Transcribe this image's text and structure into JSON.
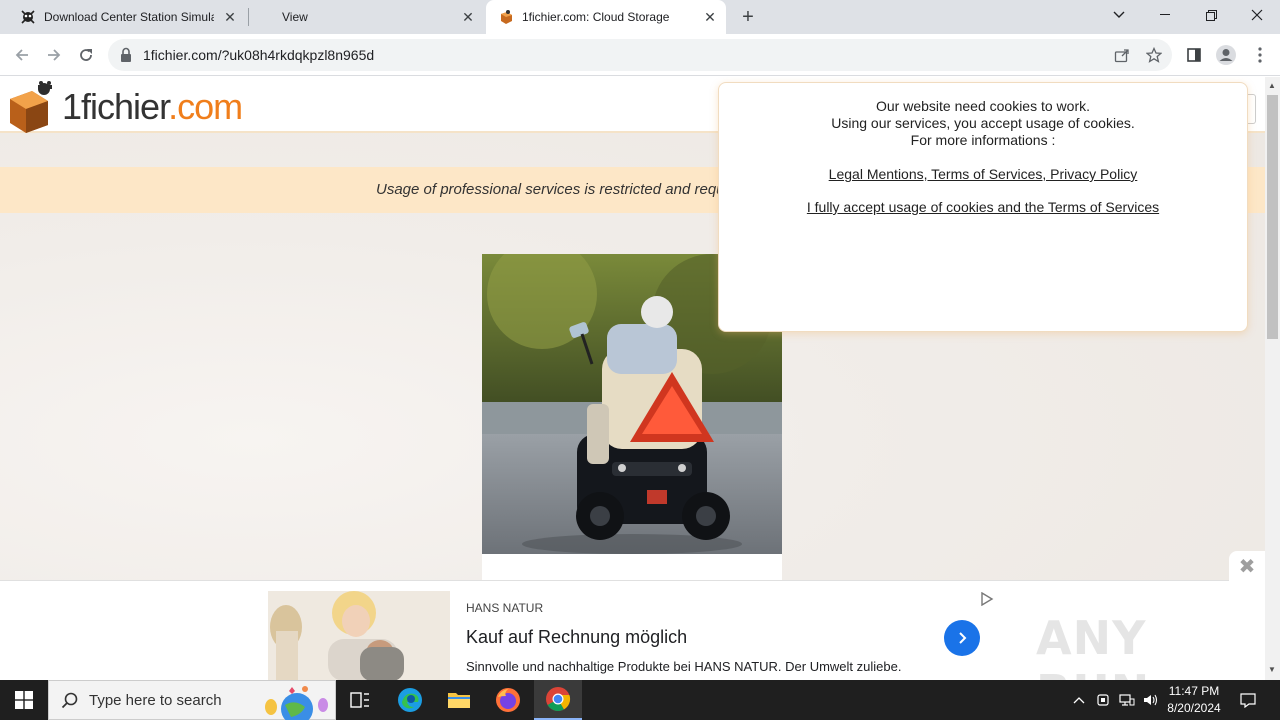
{
  "browser": {
    "tabs": [
      {
        "title": "Download Center Station Simula",
        "favicon": "anyrun-icon",
        "active": false
      },
      {
        "title": "View",
        "favicon": "",
        "active": false
      },
      {
        "title": "1fichier.com: Cloud Storage",
        "favicon": "1fichier-favicon",
        "active": true
      }
    ],
    "url": "1fichier.com/?uk08h4rkdqkpzl8n965d"
  },
  "site": {
    "logo_part1": "1fichier",
    "logo_part2": ".com",
    "notice": "Usage of professional services is restricted and requ"
  },
  "cookie_modal": {
    "line1": "Our website need cookies to work.",
    "line2": "Using our services, you accept usage of cookies.",
    "line3": "For more informations :",
    "links_text": "Legal Mentions, Terms of Services, Privacy Policy",
    "accept_text": "I fully accept usage of cookies and the Terms of Services"
  },
  "ad": {
    "brand": "HANS NATUR",
    "title": "Kauf auf Rechnung möglich",
    "description": "Sinnvolle und nachhaltige Produkte bei HANS NATUR. Der Umwelt zuliebe.",
    "watermark": "ANY RUN"
  },
  "taskbar": {
    "search_placeholder": "Type here to search",
    "time": "11:47 PM",
    "date": "8/20/2024"
  },
  "colors": {
    "brand_orange": "#f07e1b",
    "notice_bg": "#fde7c7",
    "ad_button": "#1a73e8"
  }
}
